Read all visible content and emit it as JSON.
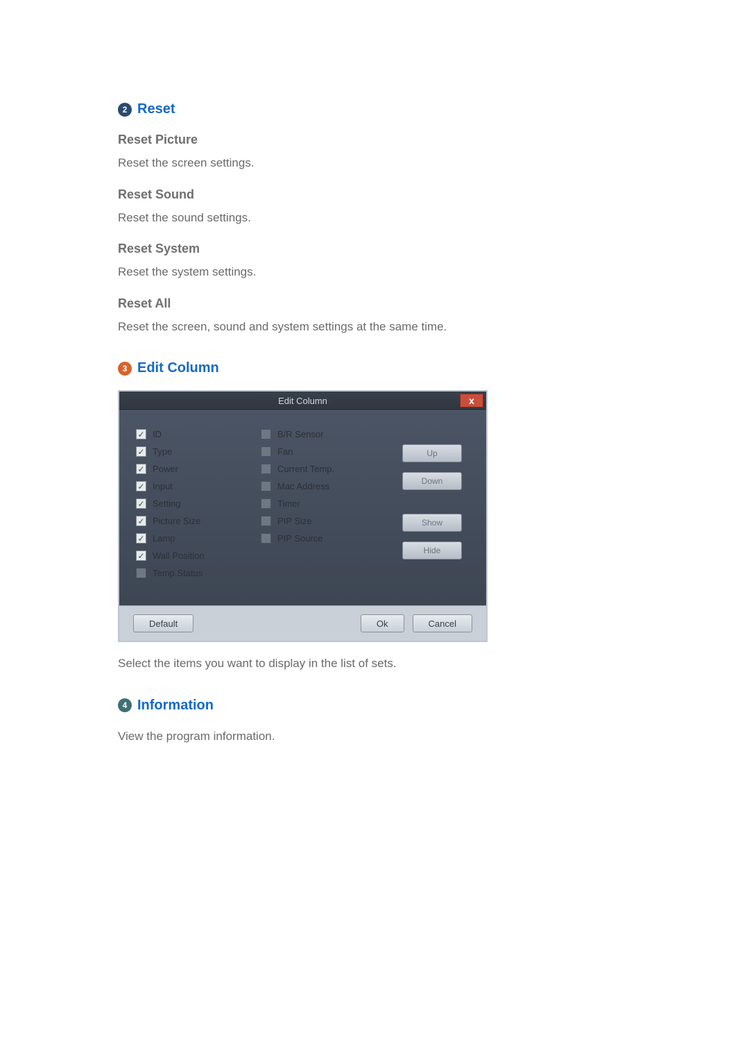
{
  "sections": {
    "reset": {
      "num": "2",
      "title": "Reset",
      "items": [
        {
          "head": "Reset Picture",
          "desc": "Reset the screen settings."
        },
        {
          "head": "Reset Sound",
          "desc": "Reset the sound settings."
        },
        {
          "head": "Reset System",
          "desc": "Reset the system settings."
        },
        {
          "head": "Reset All",
          "desc": "Reset the screen, sound and system settings at the same time."
        }
      ]
    },
    "edit_column": {
      "num": "3",
      "title": "Edit Column",
      "dialog": {
        "title": "Edit Column",
        "close": "x",
        "col1": [
          {
            "label": "ID",
            "checked": true
          },
          {
            "label": "Type",
            "checked": true
          },
          {
            "label": "Power",
            "checked": true
          },
          {
            "label": "Input",
            "checked": true
          },
          {
            "label": "Setting",
            "checked": true
          },
          {
            "label": "Picture Size",
            "checked": true
          },
          {
            "label": "Lamp",
            "checked": true
          },
          {
            "label": "Wall Position",
            "checked": true
          },
          {
            "label": "Temp.Status",
            "checked": false
          }
        ],
        "col2": [
          {
            "label": "B/R Sensor",
            "checked": false
          },
          {
            "label": "Fan",
            "checked": false
          },
          {
            "label": "Current Temp.",
            "checked": false
          },
          {
            "label": "Mac Address",
            "checked": false
          },
          {
            "label": "Timer",
            "checked": false
          },
          {
            "label": "PIP Size",
            "checked": false
          },
          {
            "label": "PIP Source",
            "checked": false
          }
        ],
        "side_buttons": {
          "up": "Up",
          "down": "Down",
          "show": "Show",
          "hide": "Hide"
        },
        "footer": {
          "default": "Default",
          "ok": "Ok",
          "cancel": "Cancel"
        }
      },
      "caption": "Select the items you want to display in the list of sets."
    },
    "information": {
      "num": "4",
      "title": "Information",
      "desc": "View the program information."
    }
  }
}
